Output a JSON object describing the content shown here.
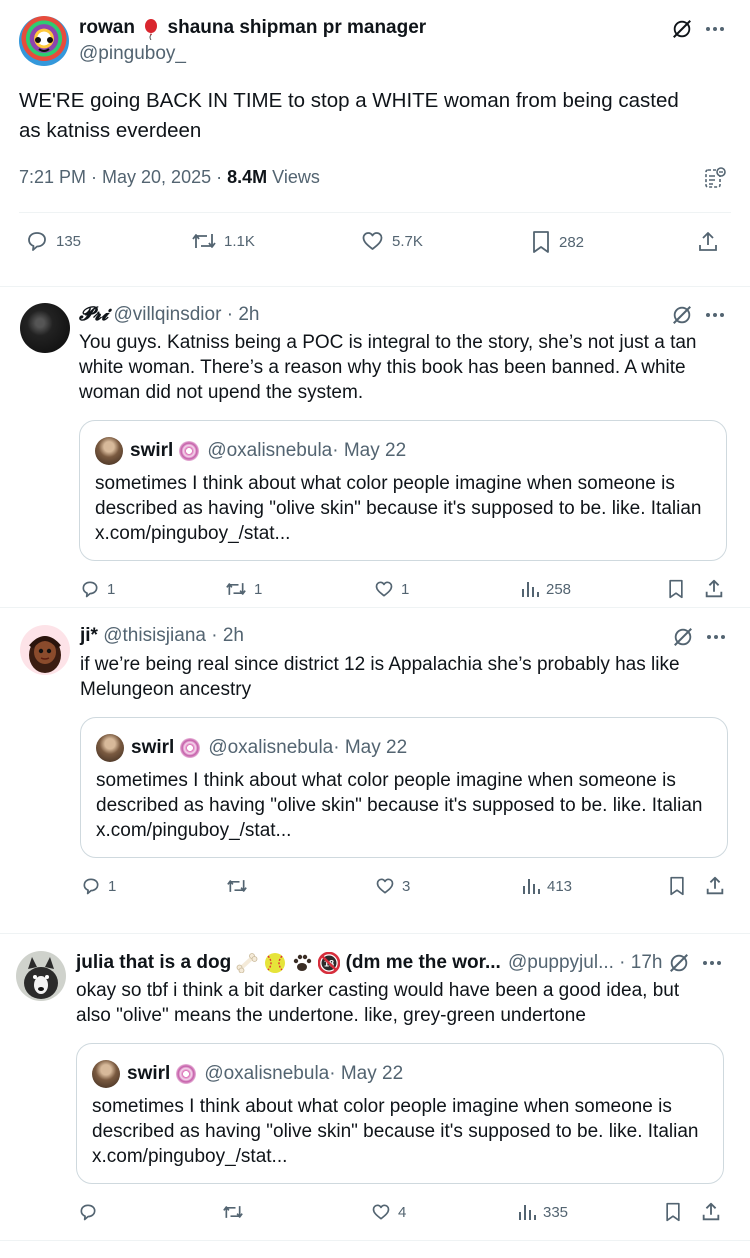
{
  "main_post": {
    "display_name": "rowan",
    "display_name_rest": "shauna shipman pr manager",
    "handle": "@pinguboy_",
    "text_line1": "WE'RE going BACK IN TIME to stop a WHITE woman from being casted",
    "text_line2": "as katniss everdeen",
    "timestamp": "7:21 PM · May 20, 2025 · ",
    "views_count": "8.4M",
    "views_label": " Views",
    "replies": "135",
    "reposts": "1.1K",
    "likes": "5.7K",
    "bookmarks": "282"
  },
  "replies": [
    {
      "name": "𝓟𝓻𝓲",
      "handle": "@villqinsdior",
      "time": " · 2h",
      "text": "You guys. Katniss being a POC is integral to the story, she’s not just a tan white woman. There’s a reason why this book has been banned. A white woman did not upend the system.",
      "quote": {
        "name": "swirl",
        "handle": "@oxalisnebula",
        "time": " · May 22",
        "text": "sometimes I think about what color people imagine when someone is described as having \"olive skin\" because it's supposed to be. like. Italian",
        "link": "x.com/pinguboy_/stat..."
      },
      "stats": {
        "replies": "1",
        "reposts": "1",
        "likes": "1",
        "views": "258"
      }
    },
    {
      "name": "ji*",
      "handle": "@thisisjiana",
      "time": " · 2h",
      "text": "if we’re being real since district 12 is Appalachia she’s probably has like Melungeon ancestry",
      "quote": {
        "name": "swirl",
        "handle": "@oxalisnebula",
        "time": " · May 22",
        "text": "sometimes I think about what color people imagine when someone is described as having \"olive skin\" because it's supposed to be. like. Italian",
        "link": "x.com/pinguboy_/stat..."
      },
      "stats": {
        "replies": "1",
        "reposts": "",
        "likes": "3",
        "views": "413"
      }
    },
    {
      "name": "julia that is a dog",
      "name_rest": "(dm me the wor...",
      "handle": "@puppyjul...",
      "time": " · 17h",
      "text": "okay so tbf i think a bit darker casting would have been a good idea, but also \"olive\" means the undertone. like, grey-green undertone",
      "quote": {
        "name": "swirl",
        "handle": "@oxalisnebula",
        "time": " · May 22",
        "text": "sometimes I think about what color people imagine when someone is described as having \"olive skin\" because it's supposed to be. like. Italian",
        "link": "x.com/pinguboy_/stat..."
      },
      "stats": {
        "replies": "",
        "reposts": "",
        "likes": "4",
        "views": "335"
      }
    }
  ],
  "colors": {
    "text": "#0f1419",
    "secondary": "#536471",
    "border": "#cfd9de",
    "divider": "#eff3f4"
  },
  "icons": [
    "grok-icon",
    "more-icon",
    "reply-icon",
    "repost-icon",
    "like-icon",
    "bookmark-icon",
    "share-icon",
    "views-icon",
    "view-quotes-icon",
    "balloon-icon",
    "bone-icon",
    "softball-icon",
    "paw-icon",
    "no-18-icon",
    "spiral-icon"
  ]
}
